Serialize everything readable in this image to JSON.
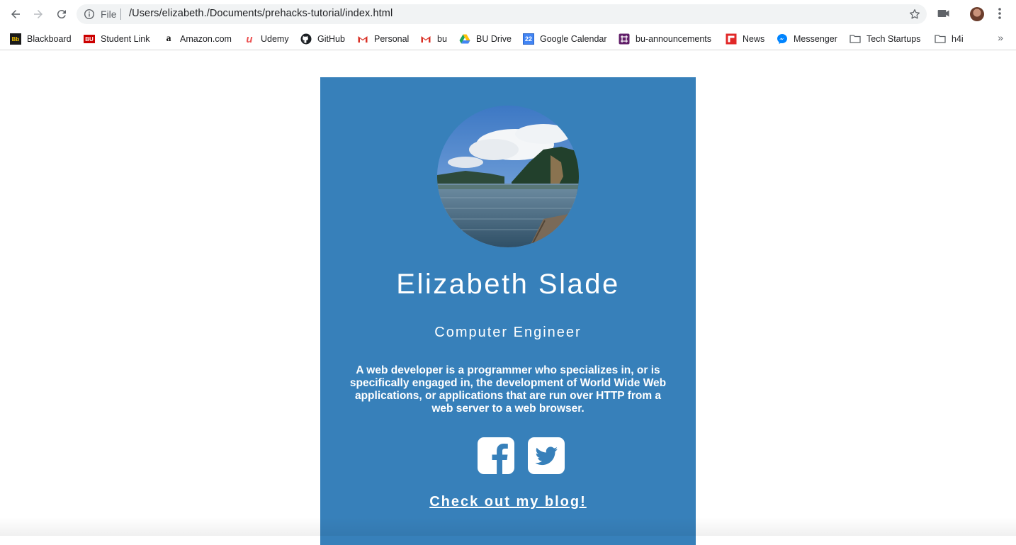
{
  "browser": {
    "url_scheme": "File",
    "url": "/Users/elizabeth./Documents/prehacks-tutorial/index.html"
  },
  "bookmarks": [
    {
      "label": "Blackboard",
      "icon": "blackboard-icon",
      "color": "#1a1a1a"
    },
    {
      "label": "Student Link",
      "icon": "bu-icon",
      "color": "#cc0000"
    },
    {
      "label": "Amazon.com",
      "icon": "amazon-icon",
      "color": "#ff9900"
    },
    {
      "label": "Udemy",
      "icon": "udemy-icon",
      "color": "#ec5252"
    },
    {
      "label": "GitHub",
      "icon": "github-icon",
      "color": "#1b1f23"
    },
    {
      "label": "Personal",
      "icon": "gmail-icon",
      "color": "#d93025"
    },
    {
      "label": "bu",
      "icon": "gmail-icon",
      "color": "#d93025"
    },
    {
      "label": "BU Drive",
      "icon": "google-drive-icon",
      "color": "#1fa463"
    },
    {
      "label": "Google Calendar",
      "icon": "google-calendar-icon",
      "color": "#4285f4",
      "icon_text": "22"
    },
    {
      "label": "bu-announcements",
      "icon": "slack-icon",
      "color": "#611f69"
    },
    {
      "label": "News",
      "icon": "flipboard-icon",
      "color": "#e12828"
    },
    {
      "label": "Messenger",
      "icon": "messenger-icon",
      "color": "#0084ff"
    },
    {
      "label": "Tech Startups",
      "icon": "folder-icon",
      "color": "#5f6368"
    },
    {
      "label": "h4i",
      "icon": "folder-icon",
      "color": "#5f6368"
    }
  ],
  "profile": {
    "name": "Elizabeth Slade",
    "role": "Computer Engineer",
    "bio": "A web developer is a programmer who specializes in, or is specifically engaged in, the development of World Wide Web applications, or applications that are run over HTTP from a web server to a web browser.",
    "blog_link": "Check out my blog!",
    "card_color": "#3780ba"
  },
  "social": [
    {
      "name": "facebook-icon"
    },
    {
      "name": "twitter-icon"
    }
  ]
}
